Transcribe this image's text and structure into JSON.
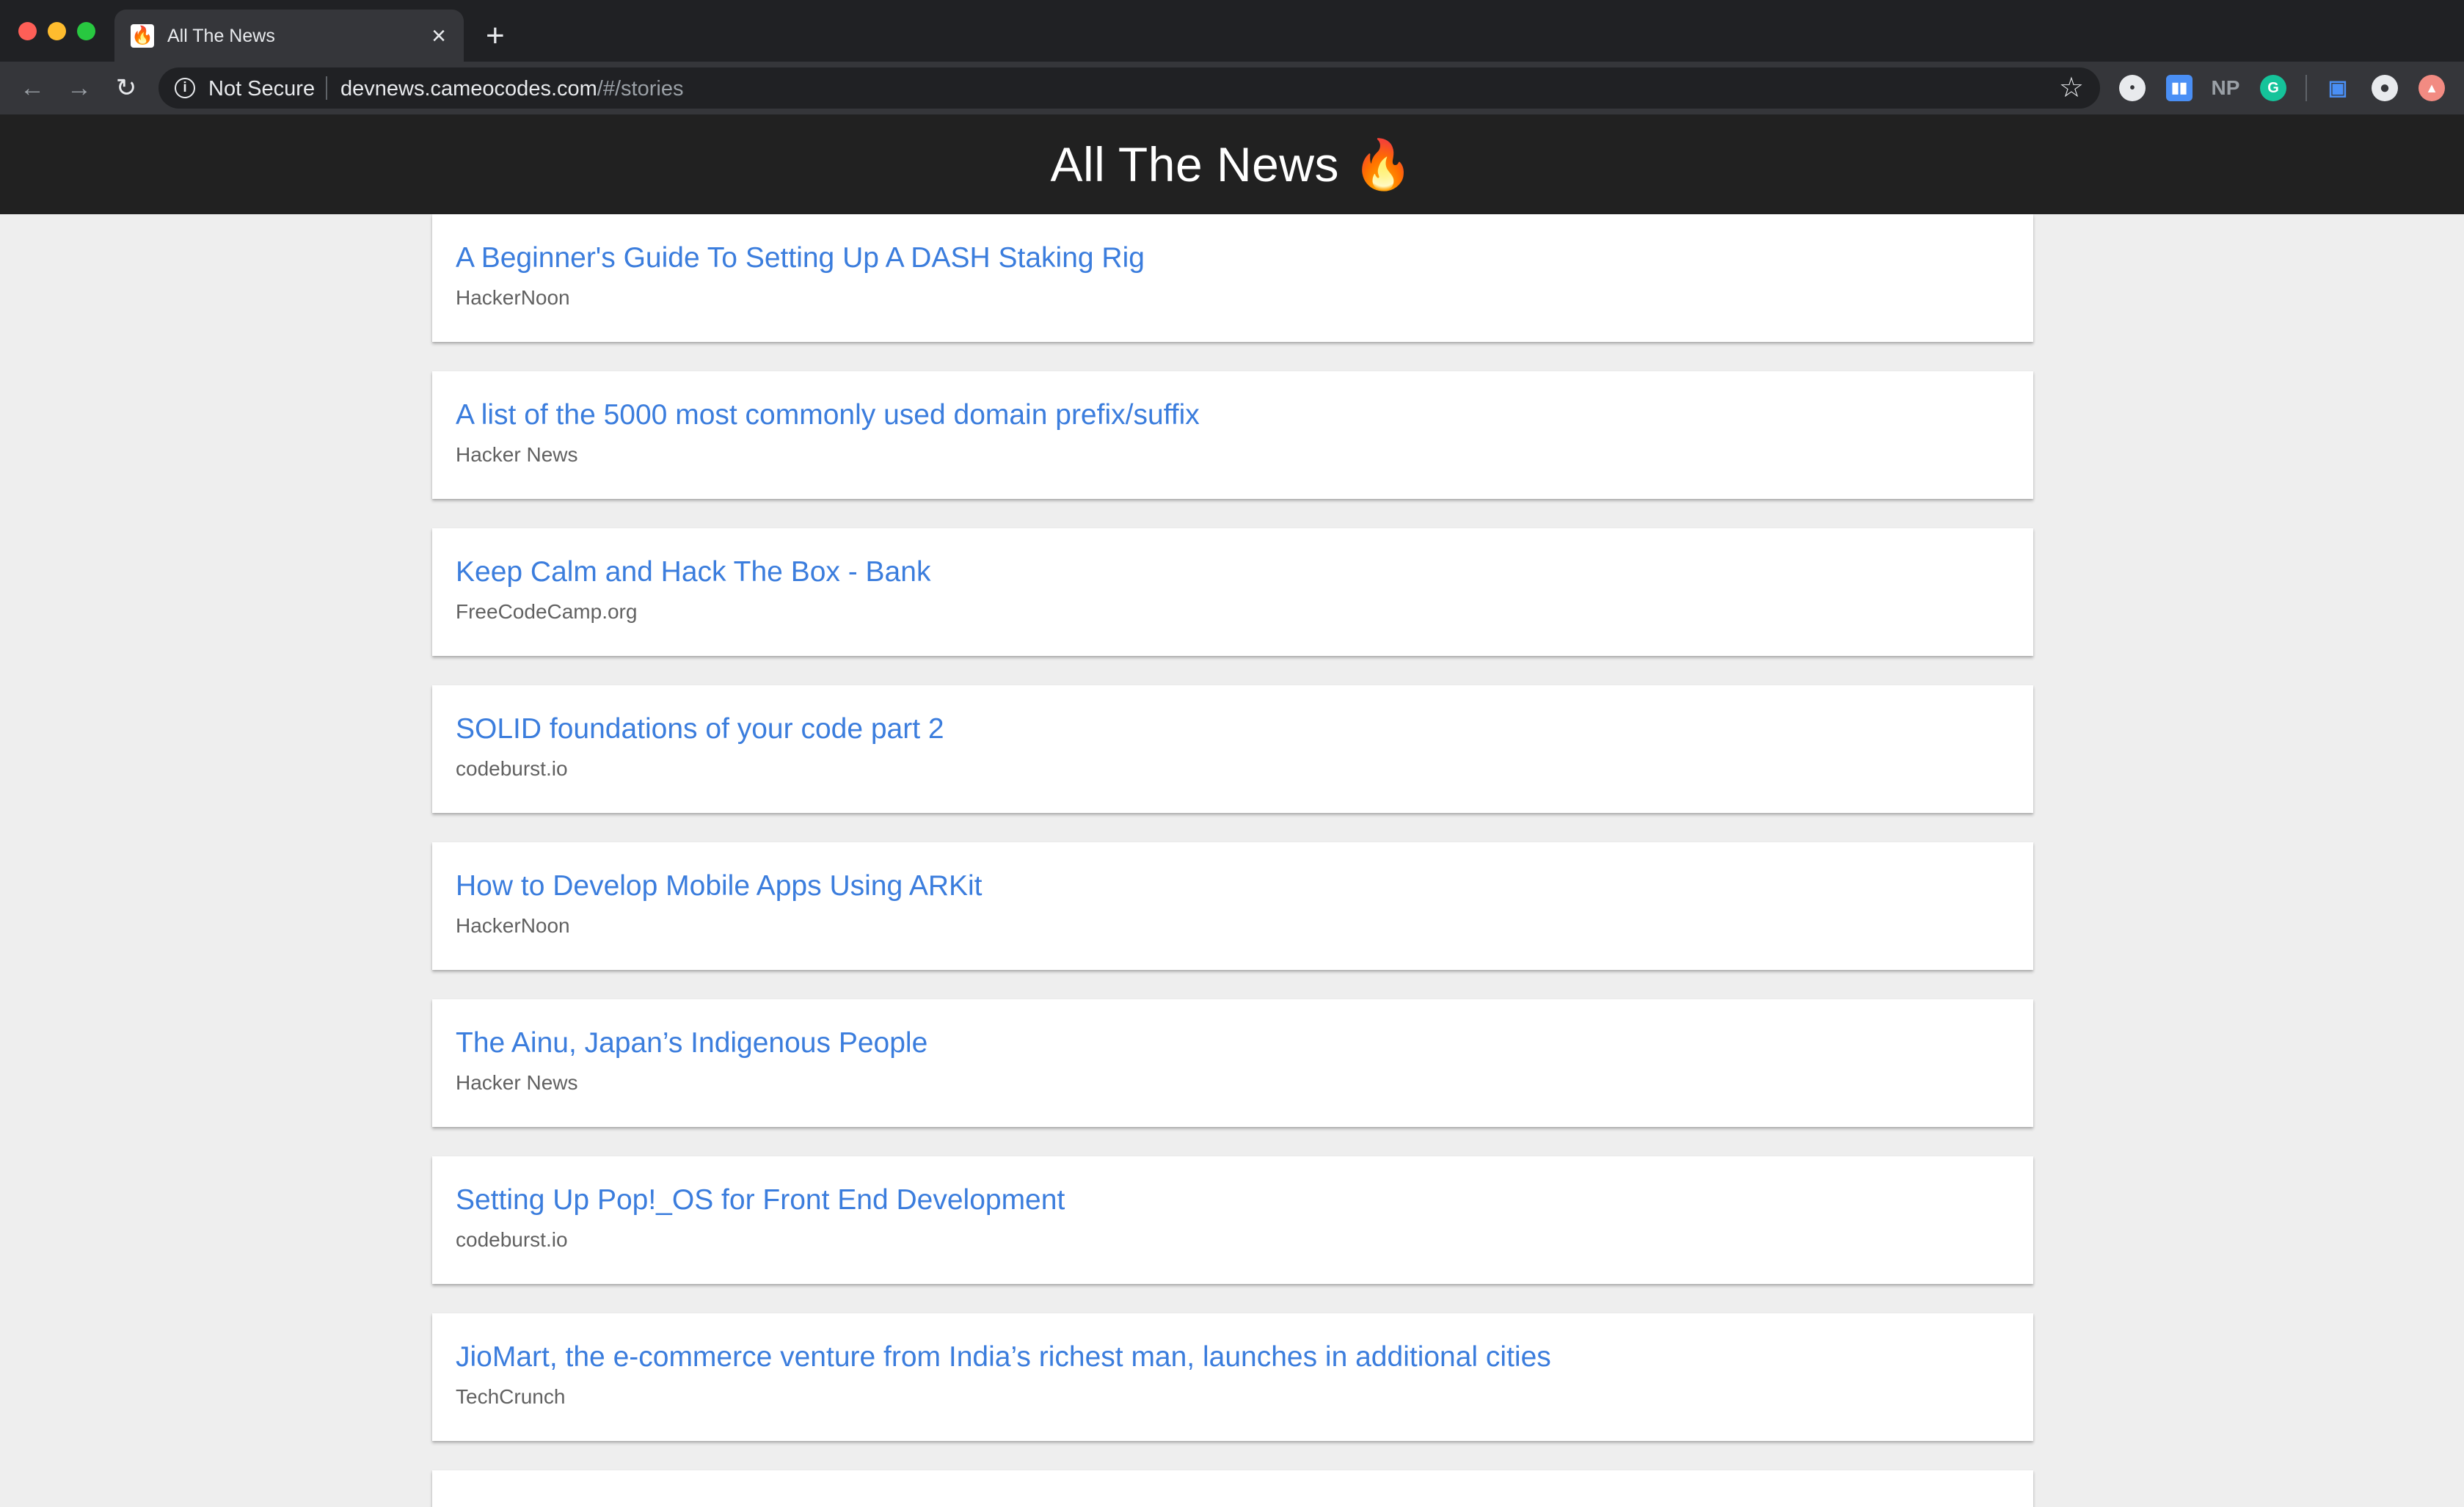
{
  "browser": {
    "tab_title": "All The News",
    "tab_favicon": "🔥",
    "close_glyph": "×",
    "new_tab_glyph": "+",
    "security_label": "Not Secure",
    "url_host": "devnews.cameocodes.com",
    "url_path": "/#/stories",
    "extensions": [
      "lastpass-icon",
      "trello-icon",
      "np-icon",
      "grammarly-icon",
      "cast-icon",
      "profile-icon",
      "extension-alert-icon"
    ],
    "ext_np_label": "NP"
  },
  "app": {
    "title": "All The News 🔥"
  },
  "stories": [
    {
      "title": "A Beginner's Guide To Setting Up A DASH Staking Rig",
      "source": "HackerNoon"
    },
    {
      "title": "A list of the 5000 most commonly used domain prefix/suffix",
      "source": "Hacker News"
    },
    {
      "title": "Keep Calm and Hack The Box - Bank",
      "source": "FreeCodeCamp.org"
    },
    {
      "title": "SOLID foundations of your code part 2",
      "source": "codeburst.io"
    },
    {
      "title": "How to Develop Mobile Apps Using ARKit",
      "source": "HackerNoon"
    },
    {
      "title": "The Ainu, Japan’s Indigenous People",
      "source": "Hacker News"
    },
    {
      "title": "Setting Up Pop!_OS for Front End Development",
      "source": "codeburst.io"
    },
    {
      "title": "JioMart, the e-commerce venture from India’s richest man, launches in additional cities",
      "source": "TechCrunch"
    }
  ],
  "colors": {
    "header_bg": "#212121",
    "link": "#3b7ddd",
    "page_bg": "#eeeeee"
  }
}
